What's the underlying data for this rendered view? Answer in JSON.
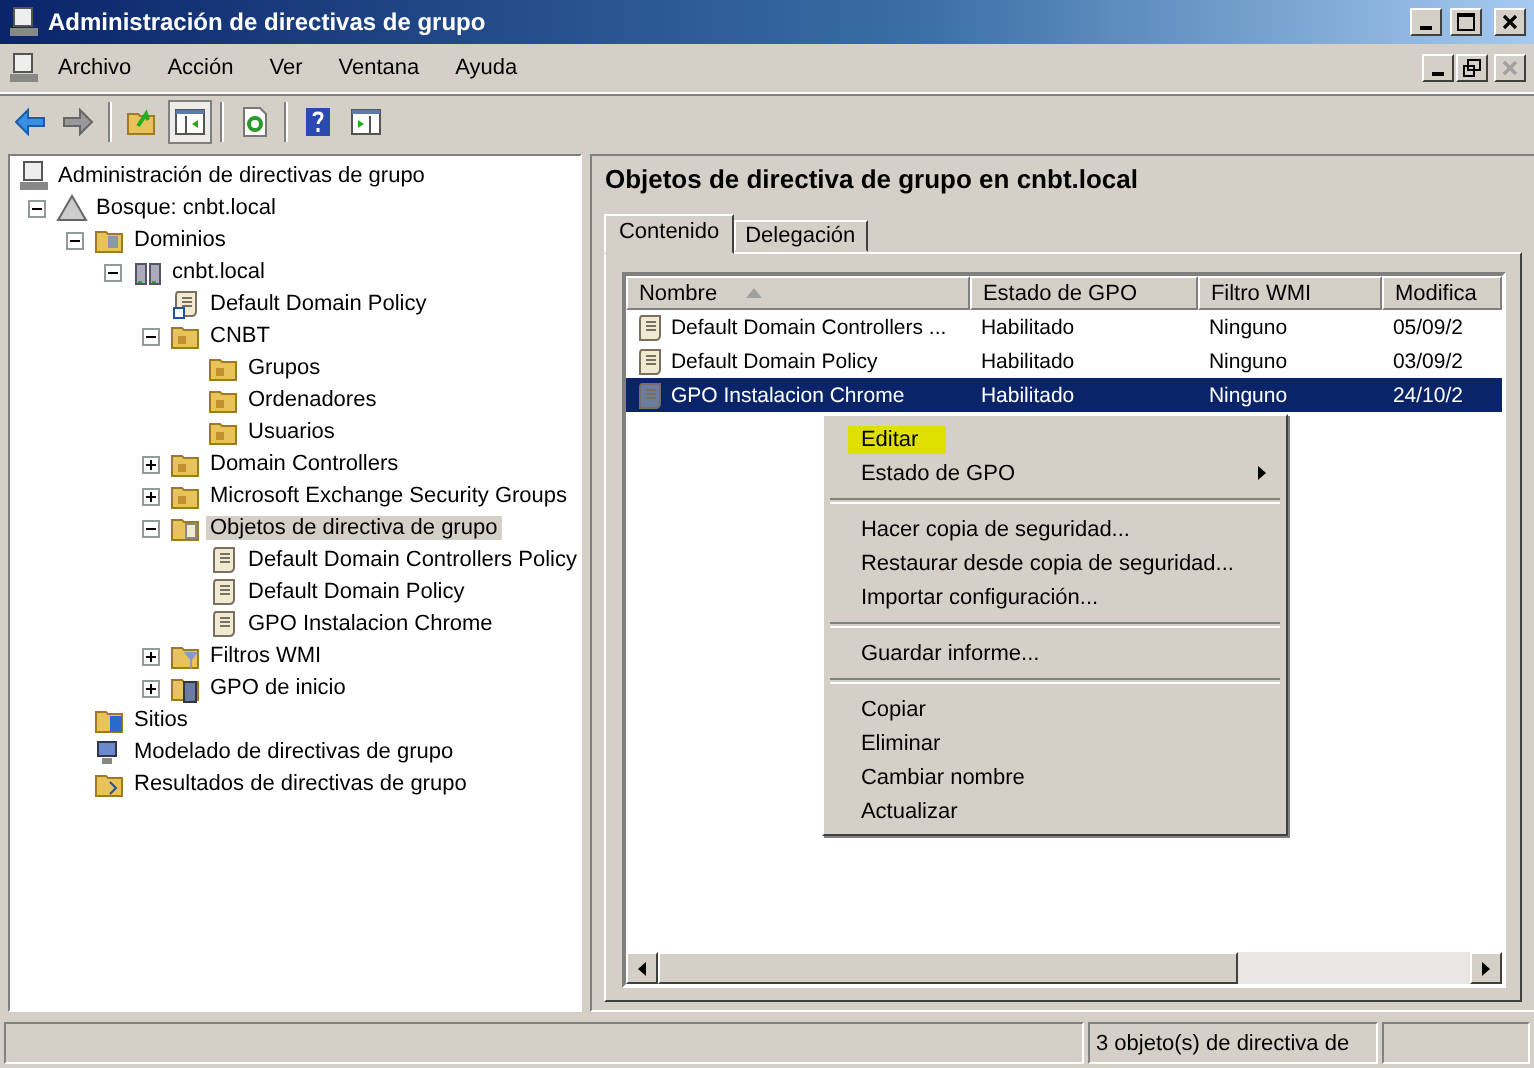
{
  "window": {
    "title": "Administración de directivas de grupo"
  },
  "menu": [
    "Archivo",
    "Acción",
    "Ver",
    "Ventana",
    "Ayuda"
  ],
  "mdi_controls": [
    {
      "kind": "minimize",
      "disabled": false
    },
    {
      "kind": "restore",
      "disabled": false
    },
    {
      "kind": "close",
      "disabled": true
    }
  ],
  "toolbar": [
    {
      "kind": "back",
      "pressed": false
    },
    {
      "kind": "forward",
      "pressed": false
    },
    {
      "kind": "separator"
    },
    {
      "kind": "up",
      "pressed": false
    },
    {
      "kind": "tree",
      "pressed": true
    },
    {
      "kind": "separator"
    },
    {
      "kind": "refresh",
      "pressed": false
    },
    {
      "kind": "separator"
    },
    {
      "kind": "help",
      "pressed": false
    },
    {
      "kind": "pane",
      "pressed": false
    }
  ],
  "tree": {
    "label": "Administración de directivas de grupo",
    "kind": "console",
    "selected": false,
    "children": [
      {
        "label": "Bosque: cnbt.local",
        "kind": "forest",
        "expanded": true,
        "selected": false,
        "children": [
          {
            "label": "Dominios",
            "kind": "domains",
            "expanded": true,
            "selected": false,
            "children": [
              {
                "label": "cnbt.local",
                "kind": "domain",
                "expanded": true,
                "selected": false,
                "children": [
                  {
                    "label": "Default Domain Policy",
                    "kind": "gpo-link",
                    "selected": false
                  },
                  {
                    "label": "CNBT",
                    "kind": "ou",
                    "expanded": true,
                    "selected": false,
                    "children": [
                      {
                        "label": "Grupos",
                        "kind": "ou",
                        "selected": false
                      },
                      {
                        "label": "Ordenadores",
                        "kind": "ou",
                        "selected": false
                      },
                      {
                        "label": "Usuarios",
                        "kind": "ou",
                        "selected": false
                      }
                    ]
                  },
                  {
                    "label": "Domain Controllers",
                    "kind": "ou",
                    "expanded": false,
                    "selected": false
                  },
                  {
                    "label": "Microsoft Exchange Security Groups",
                    "kind": "ou",
                    "expanded": false,
                    "selected": false
                  },
                  {
                    "label": "Objetos de directiva de grupo",
                    "kind": "gpo-folder",
                    "expanded": true,
                    "selected": true,
                    "children": [
                      {
                        "label": "Default Domain Controllers Policy",
                        "kind": "gpo",
                        "selected": false
                      },
                      {
                        "label": "Default Domain Policy",
                        "kind": "gpo",
                        "selected": false
                      },
                      {
                        "label": "GPO Instalacion Chrome",
                        "kind": "gpo",
                        "selected": false
                      }
                    ]
                  },
                  {
                    "label": "Filtros WMI",
                    "kind": "wmi",
                    "expanded": false,
                    "selected": false
                  },
                  {
                    "label": "GPO de inicio",
                    "kind": "starter",
                    "expanded": false,
                    "selected": false
                  }
                ]
              }
            ]
          },
          {
            "label": "Sitios",
            "kind": "sites",
            "selected": false
          },
          {
            "label": "Modelado de directivas de grupo",
            "kind": "modeling",
            "selected": false
          },
          {
            "label": "Resultados de directivas de grupo",
            "kind": "results",
            "selected": false
          }
        ]
      }
    ]
  },
  "panel": {
    "title": "Objetos de directiva de grupo en cnbt.local",
    "tabs": [
      {
        "label": "Contenido",
        "selected": true
      },
      {
        "label": "Delegación",
        "selected": false
      }
    ],
    "table": {
      "columns": [
        {
          "label": "Nombre",
          "sorted": true
        },
        {
          "label": "Estado de GPO",
          "sorted": false
        },
        {
          "label": "Filtro WMI",
          "sorted": false
        },
        {
          "label": "Modifica",
          "sorted": false
        }
      ],
      "rows": [
        {
          "cells": [
            "Default Domain Controllers ...",
            "Habilitado",
            "Ninguno",
            "05/09/2"
          ],
          "selected": false
        },
        {
          "cells": [
            "Default Domain Policy",
            "Habilitado",
            "Ninguno",
            "03/09/2"
          ],
          "selected": false
        },
        {
          "cells": [
            "GPO Instalacion Chrome",
            "Habilitado",
            "Ninguno",
            "24/10/2"
          ],
          "selected": true
        }
      ]
    }
  },
  "context_menu": [
    {
      "kind": "item",
      "label": "Editar",
      "highlighted": true
    },
    {
      "kind": "submenu",
      "label": "Estado de GPO",
      "highlighted": false
    },
    {
      "kind": "separator"
    },
    {
      "kind": "item",
      "label": "Hacer copia de seguridad...",
      "highlighted": false
    },
    {
      "kind": "item",
      "label": "Restaurar desde copia de seguridad...",
      "highlighted": false
    },
    {
      "kind": "item",
      "label": "Importar configuración...",
      "highlighted": false
    },
    {
      "kind": "separator"
    },
    {
      "kind": "item",
      "label": "Guardar informe...",
      "highlighted": false
    },
    {
      "kind": "separator"
    },
    {
      "kind": "item",
      "label": "Copiar",
      "highlighted": false
    },
    {
      "kind": "item",
      "label": "Eliminar",
      "highlighted": false
    },
    {
      "kind": "item",
      "label": "Cambiar nombre",
      "highlighted": false
    },
    {
      "kind": "item",
      "label": "Actualizar",
      "highlighted": false
    }
  ],
  "status_bar": {
    "text": "3 objeto(s) de directiva de"
  }
}
